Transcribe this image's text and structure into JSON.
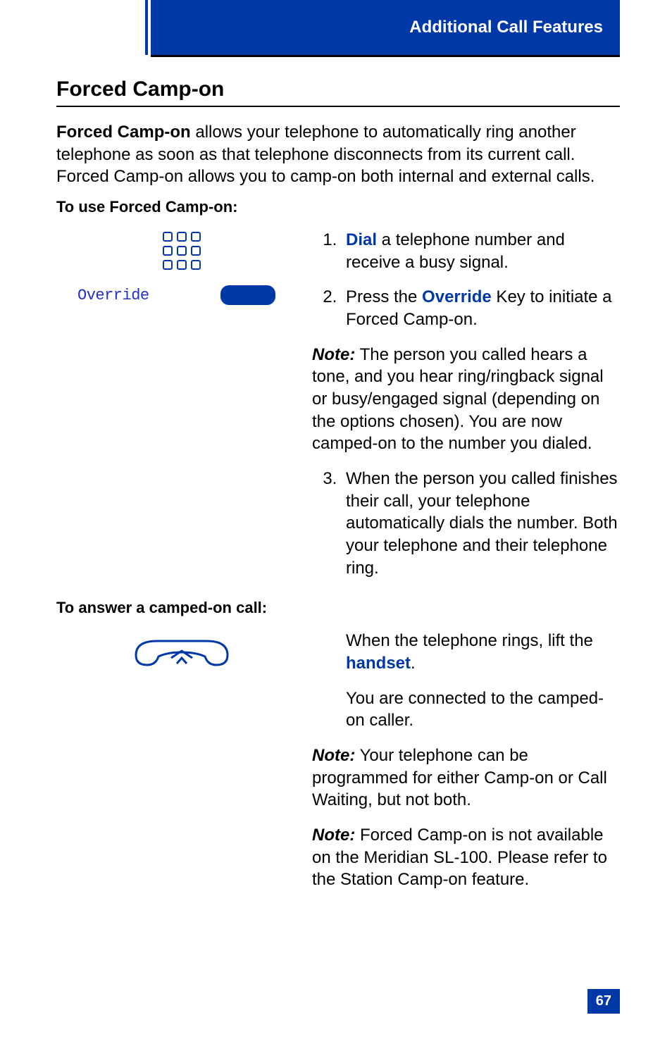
{
  "header": {
    "section_title": "Additional Call Features"
  },
  "h1": "Forced Camp-on",
  "intro": {
    "lead_bold": "Forced Camp-on",
    "rest": " allows your telephone to automatically ring another telephone as soon as that telephone disconnects from its current call. Forced Camp-on allows you to camp-on both internal and external calls."
  },
  "subhead_use": "To use Forced Camp-on:",
  "key_label": "Override",
  "steps": {
    "s1_pre": "",
    "s1_blue": "Dial",
    "s1_post": " a telephone number and receive a busy signal.",
    "s2_pre": "Press the ",
    "s2_blue": "Override",
    "s2_post": " Key to initiate a Forced Camp-on.",
    "note1_label": "Note:",
    "note1_text": " The person you called hears a tone, and you hear ring/ringback signal or busy/engaged signal (depending on the options chosen). You are now camped-on to the number you dialed.",
    "s3": "When the person you called finishes their call, your telephone automatically dials the number. Both your telephone and their telephone ring."
  },
  "subhead_answer": "To answer a camped-on call:",
  "answer": {
    "line1_pre": "When the telephone rings, lift the ",
    "line1_blue": "handset",
    "line1_post": ".",
    "line2": "You are connected to the camped-on caller.",
    "note2_label": "Note:",
    "note2_text": " Your telephone can be programmed for either Camp-on or Call Waiting, but not both.",
    "note3_label": "Note:",
    "note3_text": " Forced Camp-on is not available on the Meridian SL-100. Please refer to the Station Camp-on feature."
  },
  "page_number": "67"
}
